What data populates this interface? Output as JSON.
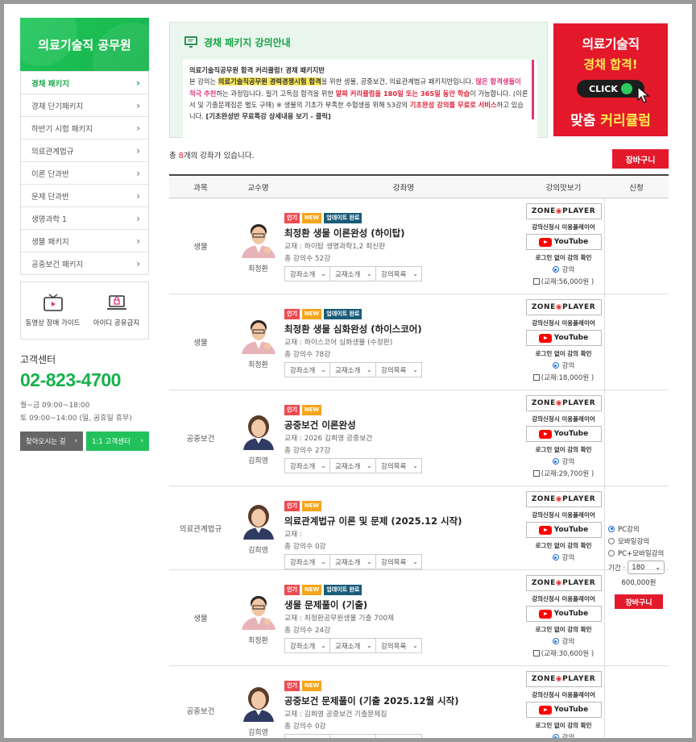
{
  "sidebar": {
    "title": "의료기술직 공무원",
    "items": [
      {
        "label": "경채 패키지",
        "active": true
      },
      {
        "label": "경채 단기패키지"
      },
      {
        "label": "하반기 시험 패키지"
      },
      {
        "label": "의료관계법규"
      },
      {
        "label": "이론 단과반"
      },
      {
        "label": "문제 단과반"
      },
      {
        "label": "생명과학 1"
      },
      {
        "label": "생물 패키지"
      },
      {
        "label": "공중보건 패키지"
      }
    ],
    "tools": {
      "video_guide": "동영상 장애 가이드",
      "id_share": "아이디 공유금지"
    },
    "cs": {
      "title": "고객센터",
      "phone": "02-823-4700",
      "hours1": "월~금 09:00~18:00",
      "hours2": "토 09:00~14:00 (일, 공휴일 휴무)",
      "btn_directions": "찾아오시는 길",
      "btn_cs": "1:1 고객센터"
    }
  },
  "notice": {
    "title": "경채 패키지 강의안내",
    "line1": "의료기술직공무원 합격 커리큘럼! 경채 패키지반",
    "p_a": "본 강의는 ",
    "p_hl1": "의료기술직공무원 경력경쟁시험 합격",
    "p_b": "을 위한 생물, 공중보건, 의료관계법규 패키지반입니다. ",
    "p_red1": "많은 합격생들이 적극 추천",
    "p_c": "하는 과정입니다. 필기 고득점 합격을 위한 ",
    "p_red2": "알짜 커리큘럼을 180일 또는 365일 동안 학습",
    "p_d": "이 가능합니다. (이론서 및 기출문제집은 별도 구매) ※ 생물의 기초가 부족한 수험생을 위해 53강의 ",
    "p_red3": "기초완성 강의를 무료로 서비스",
    "p_e": "하고 있습니다. ",
    "p_link": "[기초완성반 무료특강 상세내용 보기 - 클릭]"
  },
  "banner": {
    "line1": "의료기술직",
    "line2": "경채 합격!",
    "click": "CLICK",
    "line3a": "맞춤 ",
    "line3b": "커리큘럼"
  },
  "list": {
    "count_prefix": "총 ",
    "count": "8",
    "count_suffix": "개의 강좌가 있습니다.",
    "cart_label": "장바구니"
  },
  "table": {
    "headers": {
      "subject": "과목",
      "professor": "교수명",
      "course": "강좌명",
      "preview": "강의맛보기",
      "apply": "신청"
    },
    "badge_pop": "인기",
    "badge_new": "NEW",
    "badge_upd": "업데이트 완료",
    "zone_a": "ZONE",
    "zone_b": "PLAYER",
    "zone_caption": "강의신청시 이용플레이어",
    "youtube": "YouTube",
    "youtube_caption": "로그인 없이 강의 확인",
    "radio_lecture": "강의",
    "select_labels": [
      "강좌소개",
      "교재소개",
      "강의목록"
    ],
    "rows": [
      {
        "subject": "생물",
        "professor": "최정환",
        "title": "최정환 생물 이론완성 (하이탑)",
        "book": "교재 : 하이탑 생명과학1,2 최신판",
        "lectures": "총 강의수 52강",
        "price": "(교재:56,000원 )",
        "upd": true
      },
      {
        "subject": "생물",
        "professor": "최정환",
        "title": "최정환 생물 심화완성 (하이스코어)",
        "book": "교재 : 하이스코어 심화생물 (수정판)",
        "lectures": "총 강의수 78강",
        "price": "(교재:18,000원 )",
        "upd": true
      },
      {
        "subject": "공중보건",
        "professor": "김희영",
        "title": "공중보건 이론완성",
        "book": "교재 : 2026 김희영 공중보건",
        "lectures": "총 강의수 27강",
        "price": "(교재:29,700원 )",
        "upd": false
      },
      {
        "subject": "의료관계법규",
        "professor": "김희영",
        "title": "의료관계법규 이론 및 문제 (2025.12 시작)",
        "book": "교재 :",
        "lectures": "총 강의수 0강",
        "price": "",
        "upd": false
      },
      {
        "subject": "생물",
        "professor": "최정환",
        "title": "생물 문제풀이 (기출)",
        "book": "교재 : 최정환공무원생물 기출 700제",
        "lectures": "총 강의수 24강",
        "price": "(교재:30,600원 )",
        "upd": true
      },
      {
        "subject": "공중보건",
        "professor": "김희영",
        "title": "공중보건 문제풀이 (기출 2025.12월 시작)",
        "book": "교재 : 김희영 공중보건 기출문제집",
        "lectures": "총 강의수 0강",
        "price": "",
        "upd": false
      }
    ],
    "apply": {
      "pc": "PC강의",
      "mobile": "모바일강의",
      "pc_mobile": "PC+모바일강의",
      "period_label": "기간 :",
      "period_value": "180",
      "price": "600,000원",
      "cart": "장바구니"
    }
  }
}
